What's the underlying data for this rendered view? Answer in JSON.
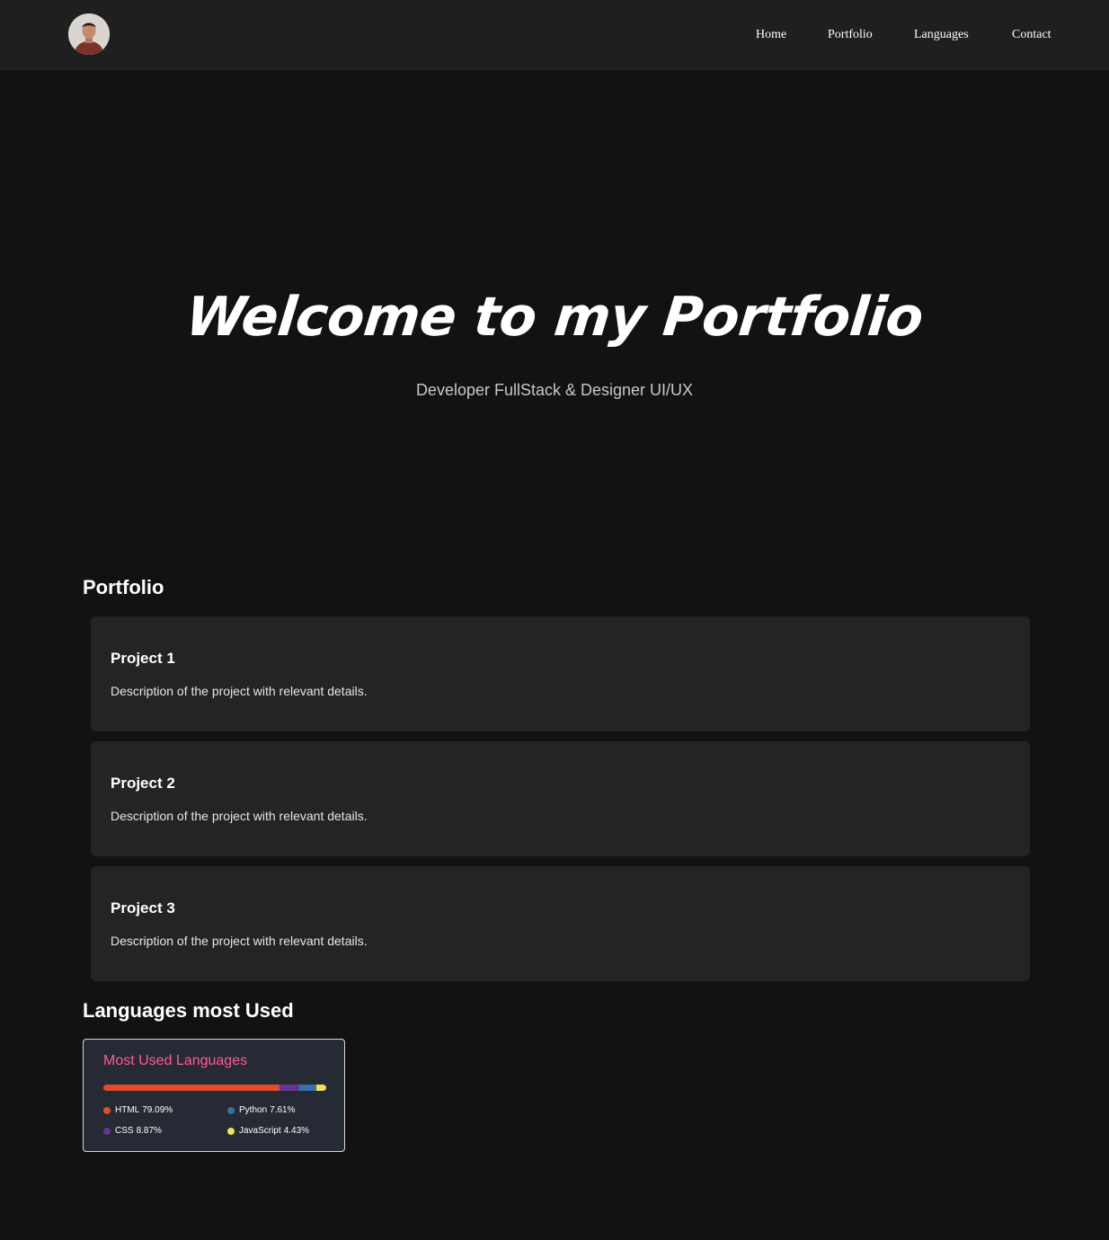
{
  "nav": {
    "items": [
      "Home",
      "Portfolio",
      "Languages",
      "Contact"
    ]
  },
  "hero": {
    "title": "Welcome to my Portfolio",
    "subtitle": "Developer FullStack & Designer UI/UX"
  },
  "portfolio": {
    "heading": "Portfolio",
    "projects": [
      {
        "title": "Project 1",
        "description": "Description of the project with relevant details."
      },
      {
        "title": "Project 2",
        "description": "Description of the project with relevant details."
      },
      {
        "title": "Project 3",
        "description": "Description of the project with relevant details."
      }
    ]
  },
  "languages": {
    "heading": "Languages most Used",
    "card_title": "Most Used Languages",
    "items": [
      {
        "name": "HTML",
        "percent": "79.09%",
        "value": 79.09,
        "color": "#e34c26"
      },
      {
        "name": "CSS",
        "percent": "8.87%",
        "value": 8.87,
        "color": "#663399"
      },
      {
        "name": "Python",
        "percent": "7.61%",
        "value": 7.61,
        "color": "#3572a5"
      },
      {
        "name": "JavaScript",
        "percent": "4.43%",
        "value": 4.43,
        "color": "#f1e05a"
      }
    ]
  },
  "colors": {
    "background": "#121212",
    "header": "#1f1f1f",
    "card": "#242424",
    "accent_title": "#fe5d8f"
  }
}
